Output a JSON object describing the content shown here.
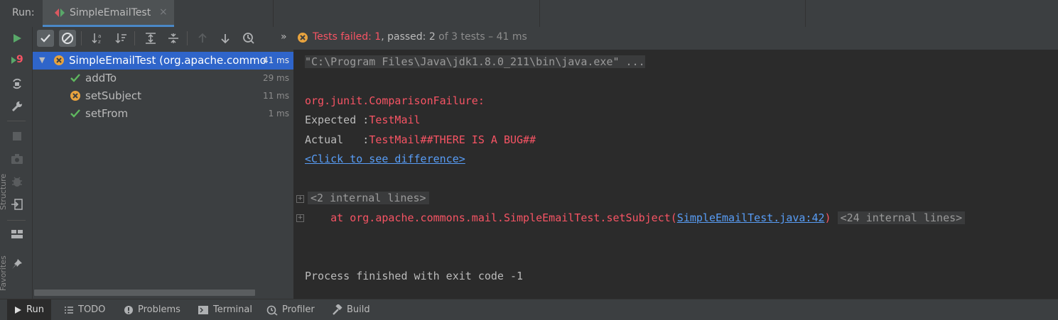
{
  "header": {
    "run_label": "Run:",
    "tab_title": "SimpleEmailTest",
    "close_glyph": "×"
  },
  "side_tools": {
    "vertical_labels": [
      "Structure",
      "Favorites"
    ],
    "rerun_badge": "9"
  },
  "status": {
    "chevron": "»",
    "failed_text": "Tests failed: ",
    "failed_count": "1",
    "passed_text": ", passed: 2",
    "rest_text": " of 3 tests – 41 ms"
  },
  "tree": {
    "root": {
      "label": "SimpleEmailTest (org.apache.commo",
      "time": "41 ms",
      "status": "failed"
    },
    "children": [
      {
        "label": "addTo",
        "time": "29 ms",
        "status": "passed"
      },
      {
        "label": "setSubject",
        "time": "11 ms",
        "status": "failed"
      },
      {
        "label": "setFrom",
        "time": "1 ms",
        "status": "passed"
      }
    ]
  },
  "console": {
    "command": "\"C:\\Program Files\\Java\\jdk1.8.0_211\\bin\\java.exe\" ...",
    "exception": "org.junit.ComparisonFailure:",
    "expected_label": "Expected :",
    "expected_value": "TestMail",
    "actual_label": "Actual   :",
    "actual_value": "TestMail##THERE IS A BUG##",
    "diff_link": "<Click to see difference>",
    "internal_lines_1": "<2 internal lines>",
    "stack_prefix": "    at org.apache.commons.mail.SimpleEmailTest.setSubject(",
    "stack_link": "SimpleEmailTest.java:42",
    "stack_suffix": ")",
    "internal_lines_2": "<24 internal lines>",
    "exit_message": "Process finished with exit code -1",
    "expand_glyph": "+"
  },
  "bottom_tabs": [
    {
      "label": "Run",
      "icon": "play-icon"
    },
    {
      "label": "TODO",
      "icon": "list-icon"
    },
    {
      "label": "Problems",
      "icon": "warning-icon"
    },
    {
      "label": "Terminal",
      "icon": "terminal-icon"
    },
    {
      "label": "Profiler",
      "icon": "profiler-icon"
    },
    {
      "label": "Build",
      "icon": "hammer-icon"
    }
  ],
  "colors": {
    "background": "#2b2b2b",
    "panel": "#3c3f41",
    "selection": "#2f65ca",
    "fail_orange": "#e8a33e",
    "pass_green": "#5fb85f",
    "error_red": "#f75464",
    "link_blue": "#589df6",
    "run_green": "#59a869"
  }
}
